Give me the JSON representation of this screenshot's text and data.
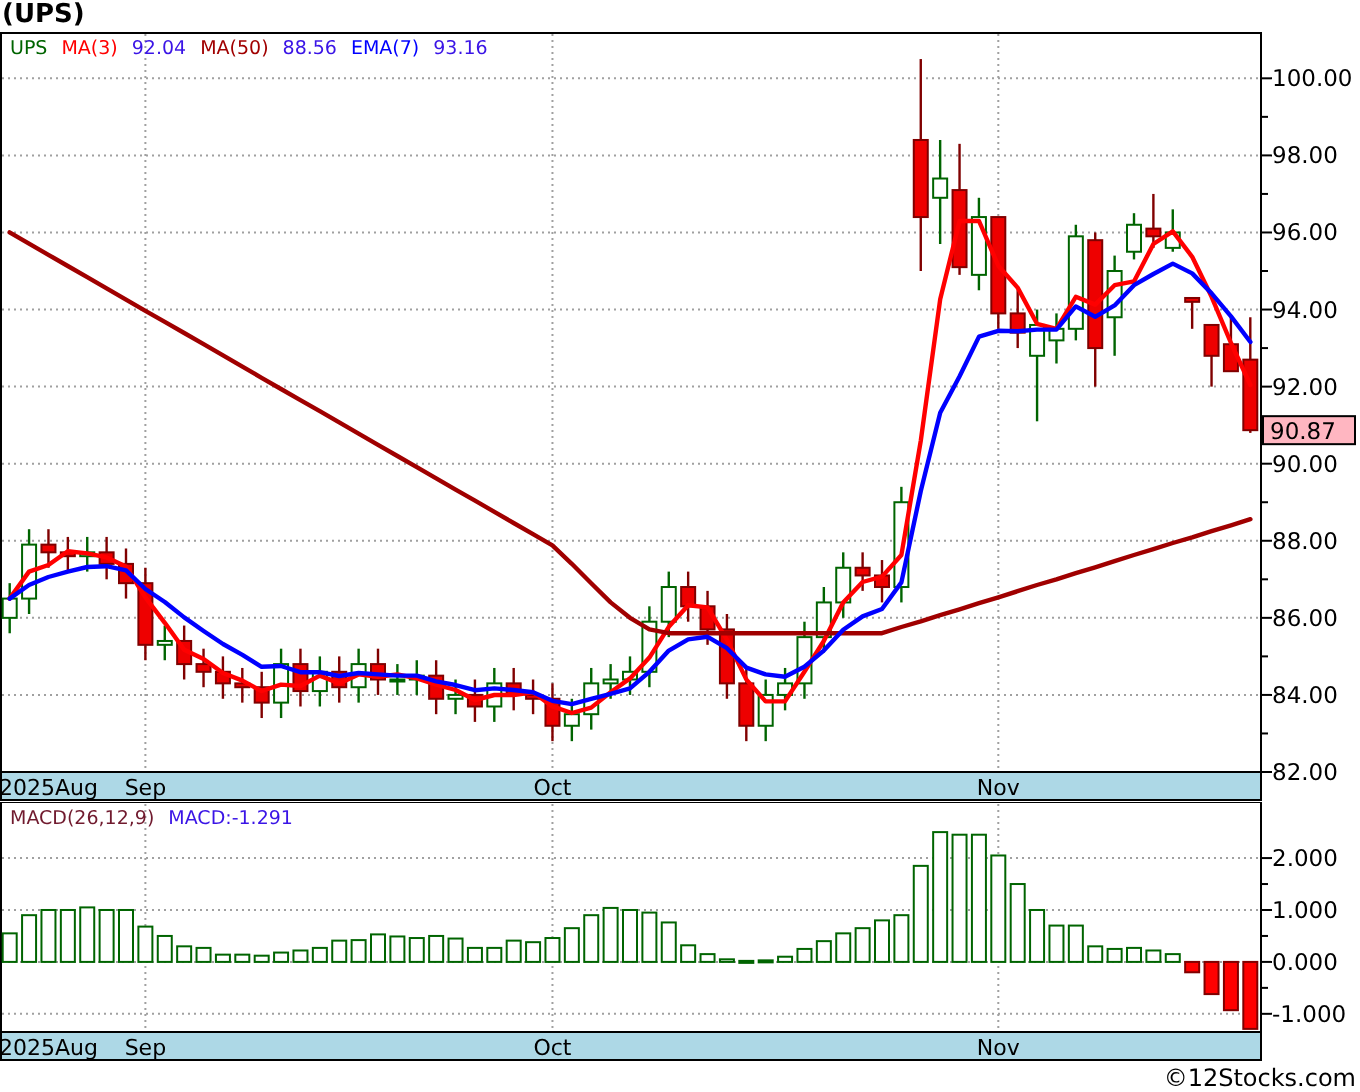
{
  "title": "(UPS)",
  "price_chart": {
    "legend": {
      "symbol": "UPS",
      "values": [
        "92.04",
        "88.56",
        "93.16"
      ]
    },
    "last_price": "90.87",
    "chart_data": {
      "type": "candlestick",
      "grid": true,
      "ylim": [
        82,
        101.15
      ],
      "categories": [
        null,
        null,
        "2025Aug",
        null,
        null,
        null,
        null,
        "Sep",
        null,
        null,
        null,
        null,
        null,
        null,
        null,
        null,
        null,
        null,
        null,
        null,
        null,
        null,
        null,
        null,
        null,
        null,
        null,
        null,
        "Oct",
        null,
        null,
        null,
        null,
        null,
        null,
        null,
        null,
        null,
        null,
        null,
        null,
        null,
        null,
        null,
        null,
        null,
        null,
        null,
        null,
        null,
        null,
        "Nov",
        null,
        null,
        null,
        null,
        null,
        null,
        null,
        null,
        null,
        null,
        null,
        null,
        null
      ],
      "yticks": [
        {
          "value": 100,
          "label": "100.00"
        },
        {
          "value": 98,
          "label": "98.00"
        },
        {
          "value": 96,
          "label": "96.00"
        },
        {
          "value": 94,
          "label": "94.00"
        },
        {
          "value": 92,
          "label": "92.00"
        },
        {
          "value": 90,
          "label": "90.00"
        },
        {
          "value": 88,
          "label": "88.00"
        },
        {
          "value": 86,
          "label": "86.00"
        },
        {
          "value": 84,
          "label": "84.00"
        },
        {
          "value": 82,
          "label": "82.00"
        }
      ],
      "ohlc": [
        [
          86.0,
          86.9,
          85.6,
          86.5
        ],
        [
          86.5,
          88.3,
          86.1,
          87.9
        ],
        [
          87.9,
          88.3,
          87.3,
          87.7
        ],
        [
          87.7,
          88.1,
          87.2,
          87.6
        ],
        [
          87.6,
          88.1,
          87.2,
          87.7
        ],
        [
          87.7,
          88.1,
          87.0,
          87.4
        ],
        [
          87.4,
          87.8,
          86.5,
          86.9
        ],
        [
          86.9,
          87.3,
          84.9,
          85.3
        ],
        [
          85.3,
          85.8,
          84.9,
          85.4
        ],
        [
          85.4,
          85.8,
          84.4,
          84.8
        ],
        [
          84.8,
          85.2,
          84.2,
          84.6
        ],
        [
          84.6,
          85.0,
          83.9,
          84.3
        ],
        [
          84.3,
          84.7,
          83.8,
          84.2
        ],
        [
          84.2,
          84.6,
          83.4,
          83.8
        ],
        [
          83.8,
          85.2,
          83.4,
          84.8
        ],
        [
          84.8,
          85.2,
          83.7,
          84.1
        ],
        [
          84.1,
          85.0,
          83.7,
          84.6
        ],
        [
          84.6,
          85.0,
          83.8,
          84.2
        ],
        [
          84.2,
          85.2,
          83.8,
          84.8
        ],
        [
          84.8,
          85.2,
          84.0,
          84.4
        ],
        [
          84.4,
          84.8,
          84.0,
          84.4
        ],
        [
          84.4,
          84.9,
          84.0,
          84.5
        ],
        [
          84.5,
          84.9,
          83.5,
          83.9
        ],
        [
          83.9,
          84.4,
          83.5,
          84.0
        ],
        [
          84.0,
          84.4,
          83.3,
          83.7
        ],
        [
          83.7,
          84.7,
          83.3,
          84.3
        ],
        [
          84.3,
          84.7,
          83.6,
          84.0
        ],
        [
          84.0,
          84.4,
          83.5,
          83.9
        ],
        [
          83.9,
          84.3,
          82.8,
          83.2
        ],
        [
          83.2,
          83.9,
          82.8,
          83.5
        ],
        [
          83.5,
          84.7,
          83.1,
          84.3
        ],
        [
          84.3,
          84.8,
          83.9,
          84.4
        ],
        [
          84.4,
          85.0,
          84.0,
          84.6
        ],
        [
          84.6,
          86.3,
          84.2,
          85.9
        ],
        [
          85.9,
          87.2,
          85.5,
          86.8
        ],
        [
          86.8,
          87.2,
          85.9,
          86.3
        ],
        [
          86.3,
          86.7,
          85.3,
          85.7
        ],
        [
          85.7,
          86.1,
          83.9,
          84.3
        ],
        [
          84.3,
          84.7,
          82.8,
          83.2
        ],
        [
          83.2,
          84.4,
          82.8,
          84.0
        ],
        [
          84.0,
          84.7,
          83.6,
          84.3
        ],
        [
          84.3,
          85.9,
          83.9,
          85.5
        ],
        [
          85.5,
          86.8,
          85.1,
          86.4
        ],
        [
          86.4,
          87.7,
          86.0,
          87.3
        ],
        [
          87.3,
          87.7,
          86.7,
          87.1
        ],
        [
          87.1,
          87.5,
          86.4,
          86.8
        ],
        [
          86.8,
          89.4,
          86.4,
          89.0
        ],
        [
          98.4,
          100.5,
          95.0,
          96.4
        ],
        [
          96.9,
          98.4,
          95.7,
          97.4
        ],
        [
          97.1,
          98.3,
          94.9,
          95.1
        ],
        [
          94.9,
          96.9,
          94.5,
          96.4
        ],
        [
          96.4,
          96.4,
          93.5,
          93.9
        ],
        [
          93.9,
          94.5,
          93.0,
          93.4
        ],
        [
          92.8,
          94.0,
          91.1,
          93.6
        ],
        [
          93.2,
          93.9,
          92.6,
          93.5
        ],
        [
          93.5,
          96.2,
          93.2,
          95.9
        ],
        [
          95.8,
          96.0,
          92.0,
          93.0
        ],
        [
          93.8,
          95.4,
          92.8,
          95.0
        ],
        [
          95.5,
          96.5,
          95.3,
          96.2
        ],
        [
          96.1,
          97.0,
          95.6,
          95.9
        ],
        [
          95.6,
          96.6,
          95.5,
          96.0
        ],
        [
          94.3,
          94.3,
          93.5,
          94.2
        ],
        [
          93.6,
          93.6,
          92.0,
          92.8
        ],
        [
          93.1,
          93.8,
          92.4,
          92.4
        ],
        [
          92.7,
          93.8,
          90.8,
          90.87
        ]
      ],
      "series": [
        {
          "name": "MA(3)",
          "type": "line",
          "color": "#ff0000",
          "values": [
            86.5,
            87.2,
            87.37,
            87.73,
            87.67,
            87.57,
            87.33,
            86.53,
            85.87,
            85.17,
            84.93,
            84.57,
            84.37,
            84.1,
            84.27,
            84.23,
            84.5,
            84.3,
            84.53,
            84.47,
            84.53,
            84.43,
            84.27,
            84.13,
            83.87,
            84.0,
            84.0,
            84.07,
            83.7,
            83.53,
            83.67,
            84.07,
            84.43,
            84.97,
            85.77,
            86.33,
            86.27,
            85.43,
            84.4,
            83.83,
            83.83,
            84.6,
            85.4,
            86.4,
            86.93,
            87.07,
            87.63,
            90.6,
            94.27,
            96.3,
            96.3,
            95.13,
            94.57,
            93.63,
            93.5,
            94.33,
            94.13,
            94.63,
            94.73,
            95.7,
            96.03,
            95.37,
            94.33,
            93.13,
            92.04
          ]
        },
        {
          "name": "MA(50)",
          "type": "line",
          "color": "#a00000",
          "values": [
            96.0,
            95.71,
            95.42,
            95.13,
            94.84,
            94.55,
            94.26,
            93.97,
            93.68,
            93.39,
            93.1,
            92.81,
            92.52,
            92.23,
            91.94,
            91.65,
            91.36,
            91.07,
            90.78,
            90.49,
            90.2,
            89.91,
            89.62,
            89.33,
            89.04,
            88.75,
            88.46,
            88.17,
            87.88,
            87.4,
            86.9,
            86.4,
            86.0,
            85.7,
            85.6,
            85.6,
            85.6,
            85.6,
            85.6,
            85.6,
            85.6,
            85.6,
            85.6,
            85.6,
            85.6,
            85.6,
            85.76,
            85.91,
            86.07,
            86.22,
            86.38,
            86.53,
            86.69,
            86.85,
            87.0,
            87.16,
            87.31,
            87.47,
            87.63,
            87.78,
            87.94,
            88.09,
            88.25,
            88.4,
            88.56
          ]
        },
        {
          "name": "EMA(7)",
          "type": "line",
          "color": "#0000ff",
          "values": [
            86.5,
            86.85,
            87.06,
            87.2,
            87.32,
            87.34,
            87.23,
            86.75,
            86.41,
            86.01,
            85.66,
            85.32,
            85.04,
            84.73,
            84.75,
            84.59,
            84.59,
            84.49,
            84.57,
            84.53,
            84.5,
            84.5,
            84.35,
            84.26,
            84.12,
            84.17,
            84.13,
            84.07,
            83.85,
            83.76,
            83.9,
            84.03,
            84.17,
            84.6,
            85.15,
            85.44,
            85.51,
            85.21,
            84.71,
            84.53,
            84.47,
            84.73,
            85.15,
            85.69,
            86.04,
            86.23,
            86.92,
            89.29,
            91.32,
            92.27,
            93.3,
            93.45,
            93.44,
            93.48,
            93.48,
            94.08,
            93.81,
            94.11,
            94.63,
            94.92,
            95.19,
            94.94,
            94.42,
            93.82,
            93.16
          ]
        }
      ]
    }
  },
  "macd_chart": {
    "legend": {
      "name": "MACD(26,12,9)",
      "reading": "MACD:-1.291"
    },
    "chart_data": {
      "type": "bar",
      "grid": true,
      "ylim": [
        -1.35,
        3.08
      ],
      "categories": [
        null,
        null,
        "2025Aug",
        null,
        null,
        null,
        null,
        "Sep",
        null,
        null,
        null,
        null,
        null,
        null,
        null,
        null,
        null,
        null,
        null,
        null,
        null,
        null,
        null,
        null,
        null,
        null,
        null,
        null,
        "Oct",
        null,
        null,
        null,
        null,
        null,
        null,
        null,
        null,
        null,
        null,
        null,
        null,
        null,
        null,
        null,
        null,
        null,
        null,
        null,
        null,
        null,
        null,
        "Nov",
        null,
        null,
        null,
        null,
        null,
        null,
        null,
        null,
        null,
        null,
        null,
        null,
        null
      ],
      "yticks": [
        {
          "value": 2,
          "label": "2.000"
        },
        {
          "value": 1,
          "label": "1.000"
        },
        {
          "value": 0,
          "label": "0.000"
        },
        {
          "value": -1,
          "label": "-1.000"
        }
      ],
      "values": [
        0.55,
        0.9,
        1.0,
        1.0,
        1.05,
        1.0,
        1.0,
        0.68,
        0.5,
        0.3,
        0.27,
        0.14,
        0.14,
        0.12,
        0.18,
        0.22,
        0.27,
        0.41,
        0.42,
        0.53,
        0.49,
        0.46,
        0.5,
        0.45,
        0.27,
        0.27,
        0.41,
        0.38,
        0.46,
        0.65,
        0.9,
        1.04,
        1.0,
        0.95,
        0.76,
        0.32,
        0.15,
        0.05,
        0.02,
        0.03,
        0.1,
        0.25,
        0.4,
        0.55,
        0.65,
        0.8,
        0.9,
        1.85,
        2.5,
        2.45,
        2.45,
        2.05,
        1.5,
        1.0,
        0.7,
        0.7,
        0.3,
        0.25,
        0.27,
        0.22,
        0.15,
        -0.2,
        -0.62,
        -0.93,
        -1.29
      ]
    }
  },
  "footer": "©12Stocks.com"
}
